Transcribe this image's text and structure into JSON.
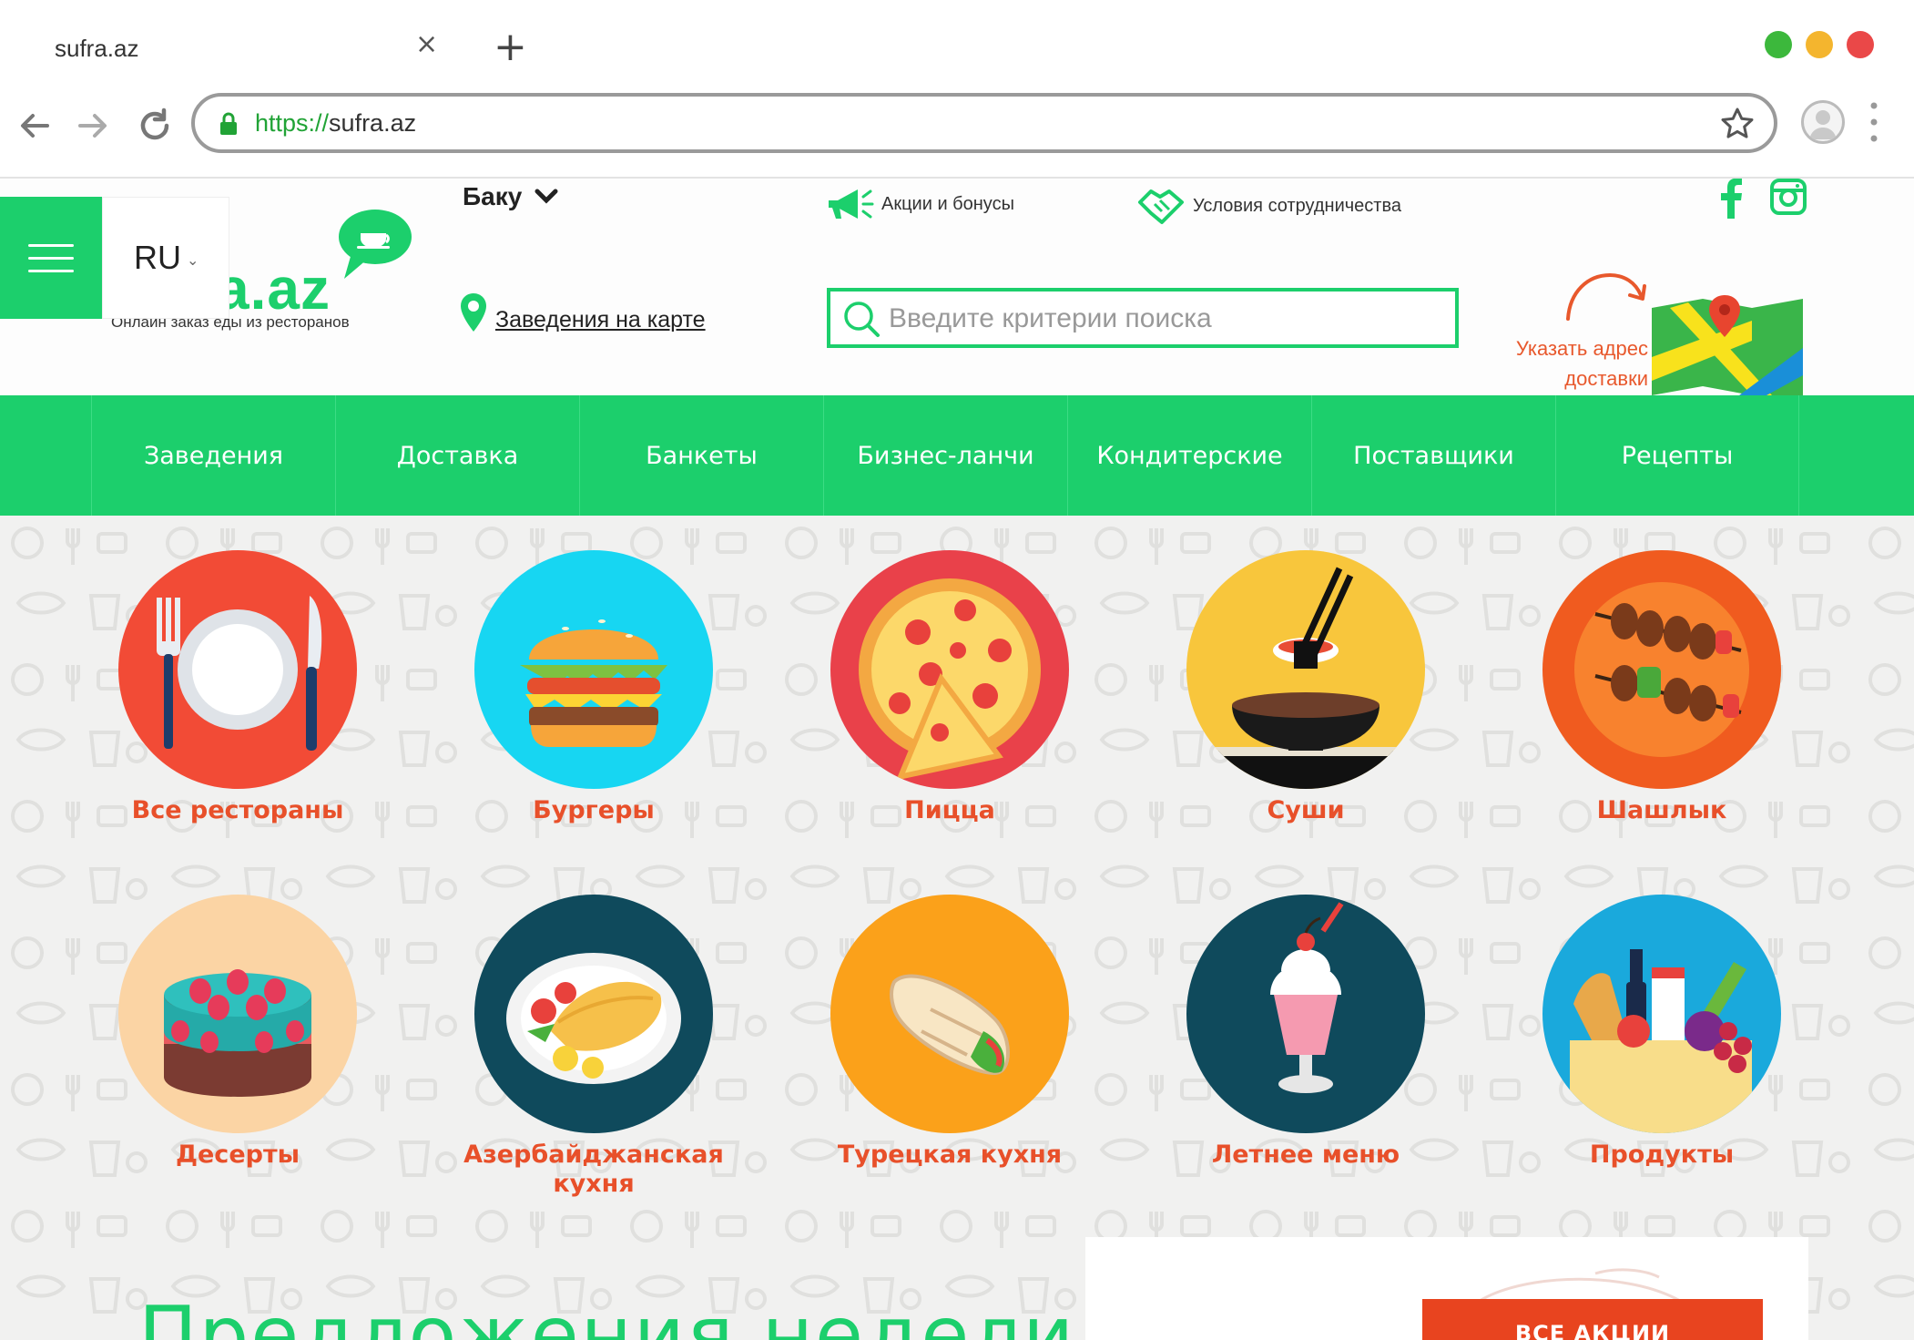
{
  "browser": {
    "tab_title": "sufra.az",
    "tab_close": "×",
    "new_tab": "+",
    "url_scheme": "https://",
    "url_host": "sufra.az",
    "window_dots": [
      "#3cb83c",
      "#f4b52e",
      "#ea4848"
    ]
  },
  "header": {
    "language": "RU",
    "logo_text": "a.az",
    "tagline": "Онлайн заказ еды из ресторанов",
    "city": "Баку",
    "promo_link": "Акции и бонусы",
    "partners_link": "Условия сотрудничества",
    "map_link": "Заведения на карте",
    "search_placeholder": "Введите критерии поиска",
    "address_line1": "Указать адрес",
    "address_line2": "доставки",
    "social": [
      "facebook-icon",
      "instagram-icon"
    ]
  },
  "nav": {
    "items": [
      "Заведения",
      "Доставка",
      "Банкеты",
      "Бизнес-ланчи",
      "Кондитерские",
      "Поставщики",
      "Рецепты"
    ]
  },
  "categories": [
    {
      "label": "Все рестораны",
      "icon": "plate-cutlery-icon",
      "color": "#f24b36"
    },
    {
      "label": "Бургеры",
      "icon": "burger-icon",
      "color": "#17d6f2"
    },
    {
      "label": "Пицца",
      "icon": "pizza-icon",
      "color": "#e9414a"
    },
    {
      "label": "Суши",
      "icon": "sushi-icon",
      "color": "#f8c63c"
    },
    {
      "label": "Шашлык",
      "icon": "kebab-icon",
      "color": "#f05b1f"
    },
    {
      "label": "Десерты",
      "icon": "cake-icon",
      "color": "#fbd4a4"
    },
    {
      "label": "Азербайджанская кухня",
      "icon": "omelette-icon",
      "color": "#0f4a5c"
    },
    {
      "label": "Турецкая кухня",
      "icon": "wrap-icon",
      "color": "#fba11a"
    },
    {
      "label": "Летнее меню",
      "icon": "milkshake-icon",
      "color": "#0f4a5c"
    },
    {
      "label": "Продукты",
      "icon": "grocery-bag-icon",
      "color": "#1aa9dc"
    }
  ],
  "weekly": {
    "title": "Предложения недели",
    "all_promos": "ВСЕ АКЦИИ"
  }
}
